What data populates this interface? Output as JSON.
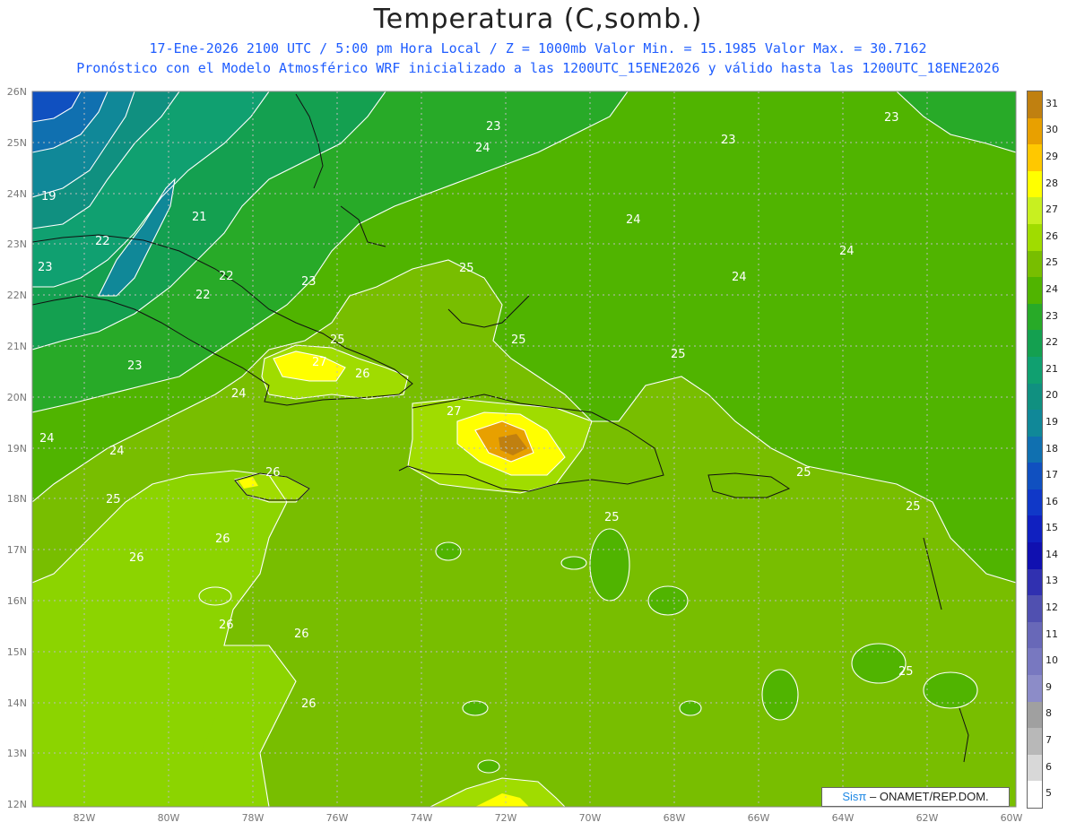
{
  "title": "Temperatura (C,somb.)",
  "subtitle_1": "17-Ene-2026 2100 UTC / 5:00 pm Hora Local / Z = 1000mb   Valor Min. = 15.1985  Valor Max. = 30.7162",
  "subtitle_2": "Pronóstico con el Modelo Atmosférico WRF inicializado a las 1200UTC_15ENE2026 y válido hasta las  1200UTC_18ENE2026",
  "subtitle_color": "#1e5cff",
  "latitudes": [
    "26N",
    "25N",
    "24N",
    "23N",
    "22N",
    "21N",
    "20N",
    "19N",
    "18N",
    "17N",
    "16N",
    "15N",
    "14N",
    "13N",
    "12N"
  ],
  "longitudes": [
    "82W",
    "80W",
    "78W",
    "76W",
    "74W",
    "72W",
    "70W",
    "68W",
    "66W",
    "64W",
    "62W",
    "60W"
  ],
  "colorbar": {
    "labels": [
      "31",
      "30",
      "29",
      "28",
      "27",
      "26",
      "25",
      "24",
      "23",
      "22",
      "21",
      "20",
      "19",
      "18",
      "17",
      "16",
      "15",
      "14",
      "13",
      "12",
      "11",
      "10",
      "9",
      "8",
      "7",
      "6",
      "5"
    ],
    "colors": [
      "#c08010",
      "#e8a000",
      "#ffc800",
      "#ffff00",
      "#c8f020",
      "#a0dc00",
      "#78be00",
      "#50b400",
      "#28aa28",
      "#14a050",
      "#10a070",
      "#109080",
      "#108898",
      "#1070b0",
      "#1050c0",
      "#1038c8",
      "#1020c0",
      "#1010b0",
      "#3030b0",
      "#5050b0",
      "#6868b8",
      "#7878c0",
      "#8c8cc8",
      "#a0a0a0",
      "#b8b8b8",
      "#d8d8d8",
      "#ffffff"
    ]
  },
  "contour_labels": [
    "19",
    "21",
    "22",
    "22",
    "22",
    "23",
    "23",
    "23",
    "23",
    "23",
    "23",
    "24",
    "24",
    "24",
    "24",
    "24",
    "24",
    "24",
    "24",
    "25",
    "25",
    "25",
    "25",
    "25",
    "25",
    "25",
    "25",
    "25",
    "26",
    "26",
    "26",
    "26",
    "26",
    "26",
    "26",
    "27",
    "27"
  ],
  "credit": {
    "brand": "Sisπ",
    "text": "– ONAMET/REP.DOM."
  }
}
